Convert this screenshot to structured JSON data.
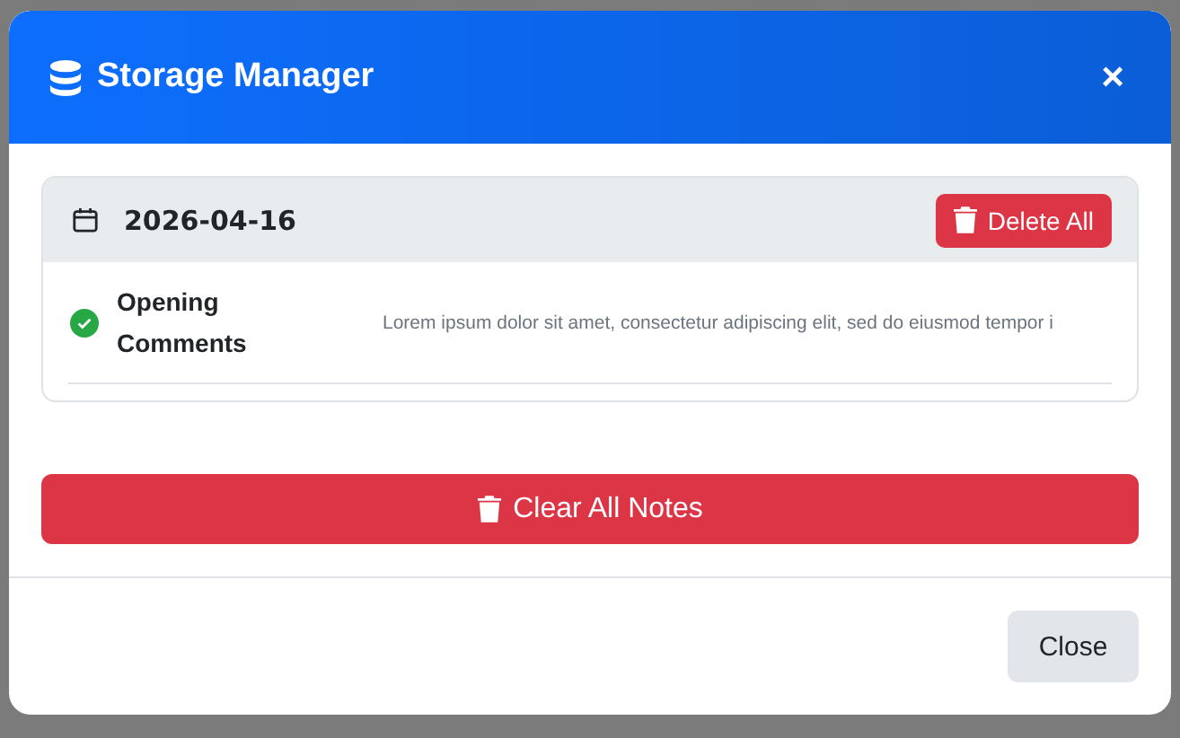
{
  "modal": {
    "title": "Storage Manager",
    "close": "×",
    "groups": [
      {
        "date": "2026-04-16",
        "delete_button": "Delete All",
        "notes": [
          {
            "title": "Opening Comments",
            "text": "Lorem ipsum dolor sit amet, consectetur adipiscing elit, sed do eiusmod tempor i",
            "saved": true
          }
        ]
      }
    ],
    "clear_button": "Clear All Notes",
    "footer_button": "Close"
  }
}
